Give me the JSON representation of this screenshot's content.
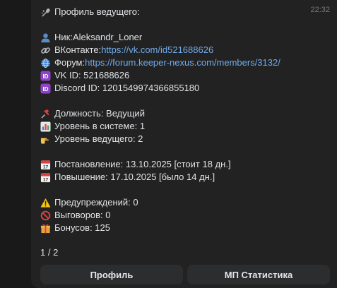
{
  "message": {
    "time": "22:32",
    "title": "Профиль ведущего:",
    "nick_label": "Ник: ",
    "nick_value": "Aleksandr_Loner",
    "vk_label": "ВКонтакте: ",
    "vk_link": "https://vk.com/id521688626",
    "forum_label": "Форум: ",
    "forum_link": "https://forum.keeper-nexus.com/members/3132/",
    "vk_id": "VK ID: 521688626",
    "discord_id": "Discord ID: 1201549974366855180",
    "position": "Должность: Ведущий",
    "system_level": "Уровень в системе: 1",
    "host_level": "Уровень ведущего: 2",
    "appointed": "Постановление: 13.10.2025 [стоит 18 дн.]",
    "promoted": "Повышение: 17.10.2025 [было 14 дн.]",
    "warnings": "Предупреждений: 0",
    "reprimands": "Выговоров: 0",
    "bonuses": "Бонусов: 125"
  },
  "pager": "1 / 2",
  "buttons": {
    "profile": "Профиль",
    "stats": "МП Статистика"
  },
  "icons": {
    "title": "microphone-icon",
    "nick": "user-silhouette-icon",
    "vk": "link-icon",
    "forum": "globe-icon",
    "vk_id": "id-badge-icon",
    "discord_id": "id-badge-icon",
    "position": "pushpin-icon",
    "system_level": "bar-chart-icon",
    "host_level": "pointing-hand-icon",
    "appointed": "calendar-icon",
    "promoted": "calendar-icon",
    "warnings": "warning-icon",
    "reprimands": "prohibited-icon",
    "bonuses": "gift-icon"
  }
}
